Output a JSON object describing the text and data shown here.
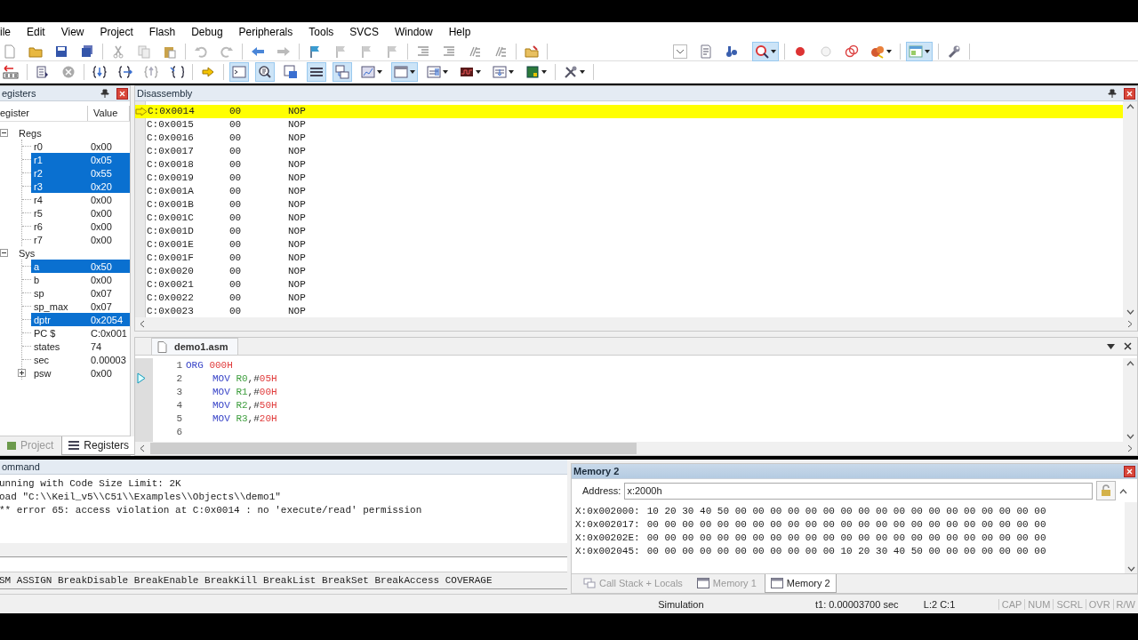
{
  "menu": [
    "ile",
    "Edit",
    "View",
    "Project",
    "Flash",
    "Debug",
    "Peripherals",
    "Tools",
    "SVCS",
    "Window",
    "Help"
  ],
  "registers_panel": {
    "title": "egisters",
    "columns": [
      "egister",
      "Value"
    ],
    "tree": [
      {
        "name": "Regs",
        "expanded": true,
        "children": [
          {
            "name": "r0",
            "value": "0x00",
            "selected": false
          },
          {
            "name": "r1",
            "value": "0x05",
            "selected": true
          },
          {
            "name": "r2",
            "value": "0x55",
            "selected": true
          },
          {
            "name": "r3",
            "value": "0x20",
            "selected": true
          },
          {
            "name": "r4",
            "value": "0x00",
            "selected": false
          },
          {
            "name": "r5",
            "value": "0x00",
            "selected": false
          },
          {
            "name": "r6",
            "value": "0x00",
            "selected": false
          },
          {
            "name": "r7",
            "value": "0x00",
            "selected": false
          }
        ]
      },
      {
        "name": "Sys",
        "expanded": true,
        "children": [
          {
            "name": "a",
            "value": "0x50",
            "selected": true
          },
          {
            "name": "b",
            "value": "0x00",
            "selected": false
          },
          {
            "name": "sp",
            "value": "0x07",
            "selected": false
          },
          {
            "name": "sp_max",
            "value": "0x07",
            "selected": false
          },
          {
            "name": "dptr",
            "value": "0x2054",
            "selected": true
          },
          {
            "name": "PC  $",
            "value": "C:0x001",
            "selected": false
          },
          {
            "name": "states",
            "value": "74",
            "selected": false
          },
          {
            "name": "sec",
            "value": "0.00003",
            "selected": false
          },
          {
            "name": "psw",
            "value": "0x00",
            "selected": false,
            "expanded": false
          }
        ]
      }
    ],
    "tabs": [
      {
        "label": "Project",
        "selected": false
      },
      {
        "label": "Registers",
        "selected": true
      }
    ]
  },
  "disassembly": {
    "title": "Disassembly",
    "rows": [
      {
        "address": "C:0x0014",
        "opcode": "00",
        "mnemonic": "NOP",
        "current": true
      },
      {
        "address": "C:0x0015",
        "opcode": "00",
        "mnemonic": "NOP",
        "current": false
      },
      {
        "address": "C:0x0016",
        "opcode": "00",
        "mnemonic": "NOP",
        "current": false
      },
      {
        "address": "C:0x0017",
        "opcode": "00",
        "mnemonic": "NOP",
        "current": false
      },
      {
        "address": "C:0x0018",
        "opcode": "00",
        "mnemonic": "NOP",
        "current": false
      },
      {
        "address": "C:0x0019",
        "opcode": "00",
        "mnemonic": "NOP",
        "current": false
      },
      {
        "address": "C:0x001A",
        "opcode": "00",
        "mnemonic": "NOP",
        "current": false
      },
      {
        "address": "C:0x001B",
        "opcode": "00",
        "mnemonic": "NOP",
        "current": false
      },
      {
        "address": "C:0x001C",
        "opcode": "00",
        "mnemonic": "NOP",
        "current": false
      },
      {
        "address": "C:0x001D",
        "opcode": "00",
        "mnemonic": "NOP",
        "current": false
      },
      {
        "address": "C:0x001E",
        "opcode": "00",
        "mnemonic": "NOP",
        "current": false
      },
      {
        "address": "C:0x001F",
        "opcode": "00",
        "mnemonic": "NOP",
        "current": false
      },
      {
        "address": "C:0x0020",
        "opcode": "00",
        "mnemonic": "NOP",
        "current": false
      },
      {
        "address": "C:0x0021",
        "opcode": "00",
        "mnemonic": "NOP",
        "current": false
      },
      {
        "address": "C:0x0022",
        "opcode": "00",
        "mnemonic": "NOP",
        "current": false
      },
      {
        "address": "C:0x0023",
        "opcode": "00",
        "mnemonic": "NOP",
        "current": false
      }
    ]
  },
  "editor": {
    "tabs": [
      {
        "label": "demo1.asm",
        "selected": true
      }
    ],
    "lines": [
      {
        "number": "1",
        "current": false,
        "indented": false,
        "tokens": [
          {
            "kind": "keyword",
            "text": "ORG"
          },
          {
            "kind": "number",
            "text": "000H"
          }
        ]
      },
      {
        "number": "2",
        "current": true,
        "indented": true,
        "tokens": [
          {
            "kind": "keyword",
            "text": "MOV"
          },
          {
            "kind": "register",
            "text": "R0"
          },
          {
            "kind": "plain",
            "text": ",#"
          },
          {
            "kind": "number",
            "text": "05H"
          }
        ]
      },
      {
        "number": "3",
        "current": false,
        "indented": true,
        "tokens": [
          {
            "kind": "keyword",
            "text": "MOV"
          },
          {
            "kind": "register",
            "text": "R1"
          },
          {
            "kind": "plain",
            "text": ",#"
          },
          {
            "kind": "number",
            "text": "00H"
          }
        ]
      },
      {
        "number": "4",
        "current": false,
        "indented": true,
        "tokens": [
          {
            "kind": "keyword",
            "text": "MOV"
          },
          {
            "kind": "register",
            "text": "R2"
          },
          {
            "kind": "plain",
            "text": ",#"
          },
          {
            "kind": "number",
            "text": "50H"
          }
        ]
      },
      {
        "number": "5",
        "current": false,
        "indented": true,
        "tokens": [
          {
            "kind": "keyword",
            "text": "MOV"
          },
          {
            "kind": "register",
            "text": "R3"
          },
          {
            "kind": "plain",
            "text": ",#"
          },
          {
            "kind": "number",
            "text": "20H"
          }
        ]
      },
      {
        "number": "6",
        "current": false
      }
    ]
  },
  "command": {
    "title": "ommand",
    "output": [
      "unning with Code Size Limit: 2K",
      "oad \"C:\\\\Keil_v5\\\\C51\\\\Examples\\\\Objects\\\\demo1\"",
      "** error 65: access violation at C:0x0014 : no 'execute/read' permission"
    ],
    "commands_hint": "SM ASSIGN BreakDisable BreakEnable BreakKill BreakList BreakSet BreakAccess COVERAGE"
  },
  "memory": {
    "title": "Memory 2",
    "address_label": "Address:",
    "address_value": "x:2000h",
    "rows": [
      {
        "address": "X:0x002000:",
        "bytes": "10 20 30 40 50 00 00 00 00 00 00 00 00 00 00 00 00 00 00 00 00 00 00"
      },
      {
        "address": "X:0x002017:",
        "bytes": "00 00 00 00 00 00 00 00 00 00 00 00 00 00 00 00 00 00 00 00 00 00 00"
      },
      {
        "address": "X:0x00202E:",
        "bytes": "00 00 00 00 00 00 00 00 00 00 00 00 00 00 00 00 00 00 00 00 00 00 00"
      },
      {
        "address": "X:0x002045:",
        "bytes": "00 00 00 00 00 00 00 00 00 00 00 10 20 30 40 50 00 00 00 00 00 00 00"
      }
    ],
    "tabs": [
      {
        "label": "Call Stack + Locals",
        "kind": "callstack",
        "selected": false
      },
      {
        "label": "Memory 1",
        "kind": "memory",
        "selected": false
      },
      {
        "label": "Memory 2",
        "kind": "memory",
        "selected": true
      }
    ]
  },
  "status_bar": {
    "mode": "Simulation",
    "time": "t1: 0.00003700 sec",
    "position": "L:2 C:1",
    "indicators": [
      "CAP",
      "NUM",
      "SCRL",
      "OVR",
      "R/W"
    ]
  }
}
